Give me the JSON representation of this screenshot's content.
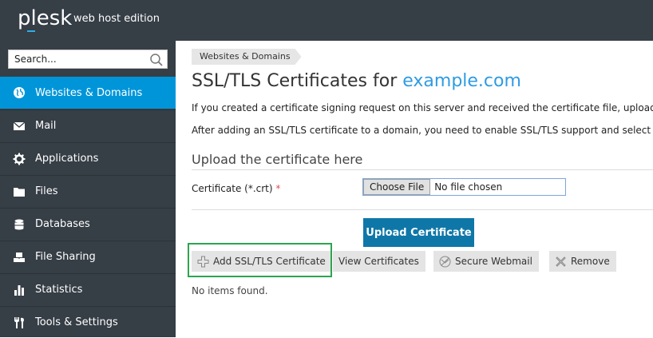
{
  "header": {
    "logo": "plesk",
    "edition": "web host edition"
  },
  "search": {
    "placeholder": "Search..."
  },
  "sidebar": {
    "items": [
      {
        "label": "Websites & Domains",
        "icon": "globe-icon",
        "active": true
      },
      {
        "label": "Mail",
        "icon": "mail-icon"
      },
      {
        "label": "Applications",
        "icon": "gear-icon"
      },
      {
        "label": "Files",
        "icon": "folder-icon"
      },
      {
        "label": "Databases",
        "icon": "database-icon"
      },
      {
        "label": "File Sharing",
        "icon": "file-sharing-icon"
      },
      {
        "label": "Statistics",
        "icon": "bar-chart-icon"
      },
      {
        "label": "Tools & Settings",
        "icon": "tools-icon"
      }
    ]
  },
  "main": {
    "breadcrumb": "Websites & Domains",
    "title_prefix": "SSL/TLS Certificates for ",
    "title_domain": "example.com",
    "para1": "If you created a certificate signing request on this server and received the certificate file, upload",
    "para2": "After adding an SSL/TLS certificate to a domain, you need to enable SSL/TLS support and select t",
    "section_title": "Upload the certificate here",
    "field_label": "Certificate (*.crt)",
    "required_mark": "*",
    "choose_file": "Choose File",
    "no_file": "No file chosen",
    "upload_button": "Upload Certificate",
    "toolbar": {
      "add": "Add SSL/TLS Certificate",
      "view": "View Certificates",
      "secure_webmail": "Secure Webmail",
      "remove": "Remove"
    },
    "empty_text": "No items found."
  },
  "colors": {
    "topbar": "#363e46",
    "active_nav": "#0095d9",
    "upload_button": "#0f77a8",
    "highlight_border": "#2ea44f",
    "link": "#2f9be3"
  }
}
